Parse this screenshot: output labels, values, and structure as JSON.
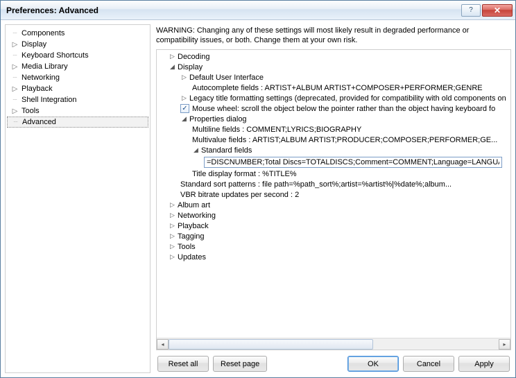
{
  "window": {
    "title": "Preferences: Advanced"
  },
  "sidebar": {
    "items": [
      {
        "label": "Components",
        "expandable": false
      },
      {
        "label": "Display",
        "expandable": true
      },
      {
        "label": "Keyboard Shortcuts",
        "expandable": false
      },
      {
        "label": "Media Library",
        "expandable": true
      },
      {
        "label": "Networking",
        "expandable": false
      },
      {
        "label": "Playback",
        "expandable": true
      },
      {
        "label": "Shell Integration",
        "expandable": false
      },
      {
        "label": "Tools",
        "expandable": true
      },
      {
        "label": "Advanced",
        "expandable": false,
        "selected": true
      }
    ]
  },
  "main": {
    "warning": "WARNING: Changing any of these settings will most likely result in degraded performance or compatibility issues, or both. Change them at your own risk.",
    "tree": {
      "decoding": "Decoding",
      "display": "Display",
      "dui": "Default User Interface",
      "autocomplete": "Autocomplete fields : ARTIST+ALBUM ARTIST+COMPOSER+PERFORMER;GENRE",
      "legacy": "Legacy title formatting settings (deprecated, provided for compatibility with old components on",
      "mousewheel": "Mouse wheel: scroll the object below the pointer rather than the object having keyboard fo",
      "propdlg": "Properties dialog",
      "multiline": "Multiline fields : COMMENT;LYRICS;BIOGRAPHY",
      "multivalue": "Multivalue fields : ARTIST;ALBUM ARTIST;PRODUCER;COMPOSER;PERFORMER;GE...",
      "stdfields": "Standard fields",
      "stdfields_value": "=DISCNUMBER;Total Discs=TOTALDISCS;Comment=COMMENT;Language=LANGUAGE",
      "titledisp": "Title display format : %TITLE%",
      "stdsort": "Standard sort patterns : file path=%path_sort%;artist=%artist%|%date%;album...",
      "vbr": "VBR bitrate updates per second : 2",
      "albumart": "Album art",
      "networking": "Networking",
      "playback": "Playback",
      "tagging": "Tagging",
      "tools": "Tools",
      "updates": "Updates"
    }
  },
  "buttons": {
    "reset_all": "Reset all",
    "reset_page": "Reset page",
    "ok": "OK",
    "cancel": "Cancel",
    "apply": "Apply"
  }
}
